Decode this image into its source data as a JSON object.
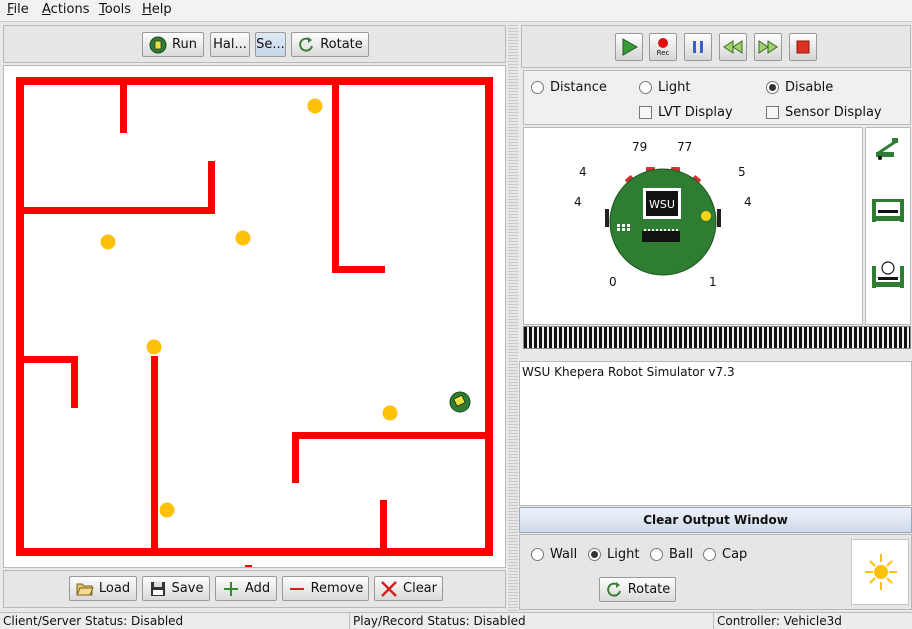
{
  "menu": {
    "items": [
      {
        "label": "File",
        "mnemonic": "F",
        "rest": "ile"
      },
      {
        "label": "Actions",
        "mnemonic": "A",
        "rest": "ctions"
      },
      {
        "label": "Tools",
        "mnemonic": "T",
        "rest": "ools"
      },
      {
        "label": "Help",
        "mnemonic": "H",
        "rest": "elp"
      }
    ]
  },
  "top_toolbar": {
    "run_label": "Run",
    "halt_label": "Hal...",
    "set_label": "Se...",
    "rotate_label": "Rotate"
  },
  "bottom_toolbar": {
    "load_label": "Load",
    "save_label": "Save",
    "add_label": "Add",
    "remove_label": "Remove",
    "clear_label": "Clear"
  },
  "playback": {
    "play_icon": "play-icon",
    "record_label": "Rec",
    "pause_icon": "pause-icon",
    "rewind_icon": "rewind-icon",
    "fast_forward_icon": "fast-forward-icon",
    "stop_icon": "stop-icon"
  },
  "sensor_mode": {
    "options": [
      "Distance",
      "Light",
      "Disable"
    ],
    "selected": "Disable",
    "lvt_label": "LVT Display",
    "sensor_display_label": "Sensor Display"
  },
  "robot": {
    "chip_label": "WSU",
    "sensor_readings": {
      "front_left": "79",
      "front_right": "77",
      "left_upper": "4",
      "left_lower": "4",
      "right_upper": "5",
      "right_lower": "4",
      "back_left": "0",
      "back_right": "1"
    },
    "body_color": "#2f7d32"
  },
  "output": {
    "text": "WSU Khepera Robot Simulator v7.3",
    "clear_label": "Clear Output Window"
  },
  "object_type": {
    "options": [
      "Wall",
      "Light",
      "Ball",
      "Cap"
    ],
    "selected": "Light",
    "rotate_label": "Rotate"
  },
  "status": {
    "client_server": "Client/Server Status: Disabled",
    "play_record": "Play/Record Status: Disabled",
    "controller": "Controller: Vehicle3d"
  },
  "colors": {
    "wall": "#ff0000",
    "light": "#ffc107",
    "robot": "#2f7d32"
  }
}
